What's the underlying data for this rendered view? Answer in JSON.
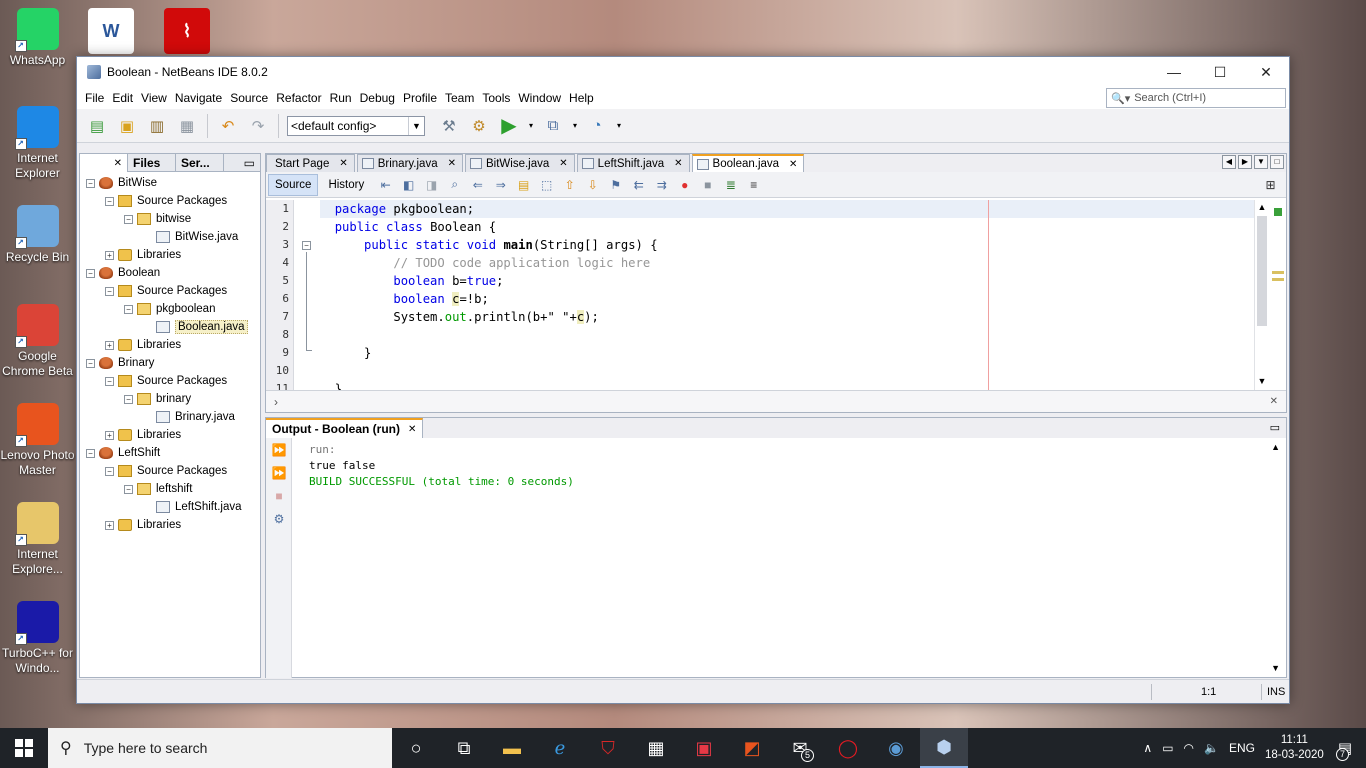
{
  "desktop": {
    "icons": [
      {
        "label": "WhatsApp",
        "icon": "whatsapp-icon",
        "color": "#25d366"
      },
      {
        "label": "Internet Explorer",
        "icon": "ie-icon",
        "color": "#1e88e5"
      },
      {
        "label": "Recycle Bin",
        "icon": "recycle-bin-icon",
        "color": "#6fa8dc"
      },
      {
        "label": "Google Chrome Beta",
        "icon": "chrome-beta-icon",
        "color": "#db4437"
      },
      {
        "label": "Lenovo Photo Master",
        "icon": "lenovo-photo-icon",
        "color": "#e8541e"
      },
      {
        "label": "Internet Explore...",
        "icon": "ie-folder-icon",
        "color": "#e7c66a"
      },
      {
        "label": "TurboC++ for Windo...",
        "icon": "turboc-icon",
        "color": "#1a1aa8"
      }
    ],
    "top_icons": [
      "word-icon",
      "pdf-icon"
    ],
    "word_letter": "W"
  },
  "window": {
    "title": "Boolean - NetBeans IDE 8.0.2",
    "minimize": "—",
    "maximize": "☐",
    "close": "✕"
  },
  "menu": [
    "File",
    "Edit",
    "View",
    "Navigate",
    "Source",
    "Refactor",
    "Run",
    "Debug",
    "Profile",
    "Team",
    "Tools",
    "Window",
    "Help"
  ],
  "search": {
    "placeholder": "Search (Ctrl+I)"
  },
  "toolbar": {
    "config": "<default config>"
  },
  "projects_panel": {
    "tabs": [
      "",
      "Files",
      "Ser..."
    ],
    "tree": [
      {
        "label": "BitWise",
        "kind": "project",
        "depth": 0,
        "toggle": "−"
      },
      {
        "label": "Source Packages",
        "kind": "pkgs",
        "depth": 1,
        "toggle": "−"
      },
      {
        "label": "bitwise",
        "kind": "pkg",
        "depth": 2,
        "toggle": "−"
      },
      {
        "label": "BitWise.java",
        "kind": "java",
        "depth": 3,
        "toggle": ""
      },
      {
        "label": "Libraries",
        "kind": "lib",
        "depth": 1,
        "toggle": "+"
      },
      {
        "label": "Boolean",
        "kind": "project",
        "depth": 0,
        "toggle": "−"
      },
      {
        "label": "Source Packages",
        "kind": "pkgs",
        "depth": 1,
        "toggle": "−"
      },
      {
        "label": "pkgboolean",
        "kind": "pkg",
        "depth": 2,
        "toggle": "−"
      },
      {
        "label": "Boolean.java",
        "kind": "java",
        "depth": 3,
        "toggle": "",
        "selected": true
      },
      {
        "label": "Libraries",
        "kind": "lib",
        "depth": 1,
        "toggle": "+"
      },
      {
        "label": "Brinary",
        "kind": "project",
        "depth": 0,
        "toggle": "−"
      },
      {
        "label": "Source Packages",
        "kind": "pkgs",
        "depth": 1,
        "toggle": "−"
      },
      {
        "label": "brinary",
        "kind": "pkg",
        "depth": 2,
        "toggle": "−"
      },
      {
        "label": "Brinary.java",
        "kind": "java",
        "depth": 3,
        "toggle": ""
      },
      {
        "label": "Libraries",
        "kind": "lib",
        "depth": 1,
        "toggle": "+"
      },
      {
        "label": "LeftShift",
        "kind": "project",
        "depth": 0,
        "toggle": "−"
      },
      {
        "label": "Source Packages",
        "kind": "pkgs",
        "depth": 1,
        "toggle": "−"
      },
      {
        "label": "leftshift",
        "kind": "pkg",
        "depth": 2,
        "toggle": "−"
      },
      {
        "label": "LeftShift.java",
        "kind": "java",
        "depth": 3,
        "toggle": ""
      },
      {
        "label": "Libraries",
        "kind": "lib",
        "depth": 1,
        "toggle": "+"
      }
    ]
  },
  "editor": {
    "tabs": [
      {
        "label": "Start Page",
        "icon": false,
        "active": false
      },
      {
        "label": "Brinary.java",
        "icon": true,
        "active": false
      },
      {
        "label": "BitWise.java",
        "icon": true,
        "active": false
      },
      {
        "label": "LeftShift.java",
        "icon": true,
        "active": false
      },
      {
        "label": "Boolean.java",
        "icon": true,
        "active": true
      }
    ],
    "modes": {
      "source": "Source",
      "history": "History"
    },
    "line_numbers": [
      "1",
      "2",
      "3",
      "4",
      "5",
      "6",
      "7",
      "8",
      "9",
      "10",
      "11"
    ],
    "code": {
      "l1_kw": "package",
      "l1_rest": " pkgboolean;",
      "l2_kw": "public class",
      "l2_rest": " Boolean {",
      "l3_kw": "public static void",
      "l3_name": "main",
      "l3_rest": "(String[] args) {",
      "l4_comment": "// TODO code application logic here",
      "l5_kw": "boolean",
      "l5_var": " b=",
      "l5_val": "true",
      "l5_end": ";",
      "l6_kw": "boolean",
      "l6_var": "c",
      "l6_rest": "=!b;",
      "l7_a": "System.",
      "l7_out": "out",
      "l7_b": ".println(b+\" \"+",
      "l7_var": "c",
      "l7_end": ");",
      "l9": "}",
      "l11": "}"
    }
  },
  "output": {
    "tab": "Output - Boolean (run)",
    "lines": {
      "run": "run:",
      "result": "true false",
      "build": "BUILD SUCCESSFUL (total time: 0 seconds)"
    }
  },
  "status": {
    "position": "1:1",
    "mode": "INS"
  },
  "taskbar": {
    "search_placeholder": "Type here to search",
    "mail_badge": "5",
    "lang": "ENG",
    "time": "11:11",
    "date": "18-03-2020",
    "notif_count": "7"
  }
}
